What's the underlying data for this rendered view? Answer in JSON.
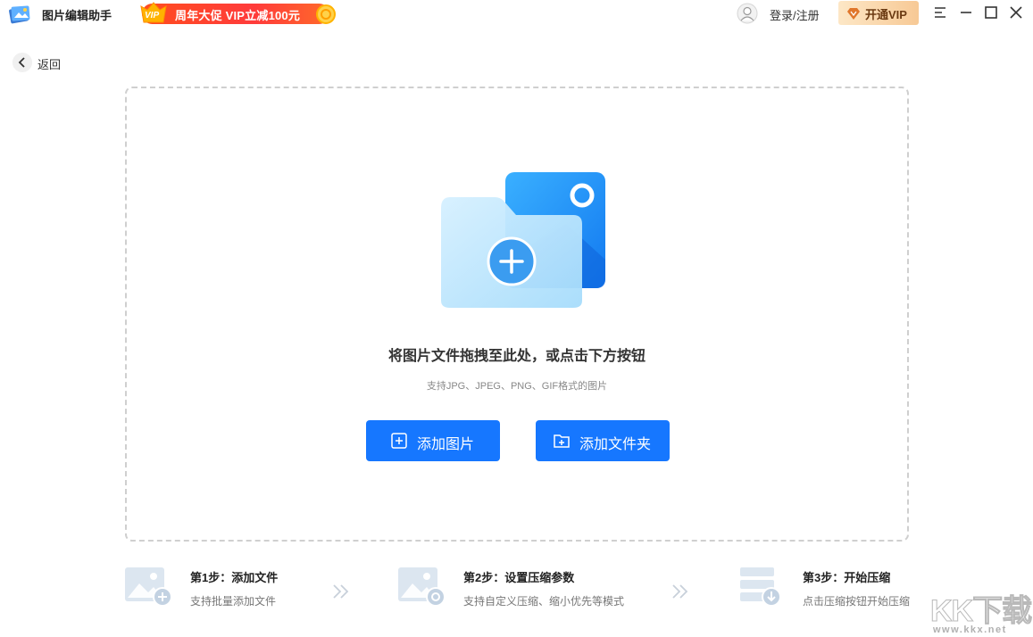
{
  "titlebar": {
    "app_title": "图片编辑助手",
    "promo_badge": "VIP",
    "promo_text": "周年大促 VIP立减100元",
    "login_label": "登录/注册",
    "vip_button_label": "开通VIP"
  },
  "nav": {
    "back_label": "返回"
  },
  "dropzone": {
    "title": "将图片文件拖拽至此处，或点击下方按钮",
    "subtitle": "支持JPG、JPEG、PNG、GIF格式的图片",
    "add_image_label": "添加图片",
    "add_folder_label": "添加文件夹"
  },
  "steps": [
    {
      "title": "第1步：添加文件",
      "desc": "支持批量添加文件"
    },
    {
      "title": "第2步：设置压缩参数",
      "desc": "支持自定义压缩、缩小优先等模式"
    },
    {
      "title": "第3步：开始压缩",
      "desc": "点击压缩按钮开始压缩"
    }
  ],
  "watermark": {
    "text": "KK下载",
    "url": "www.kkx.net"
  },
  "colors": {
    "primary": "#1677ff",
    "promo": "#ff3b3b",
    "vip_gold": "#f7c995"
  }
}
